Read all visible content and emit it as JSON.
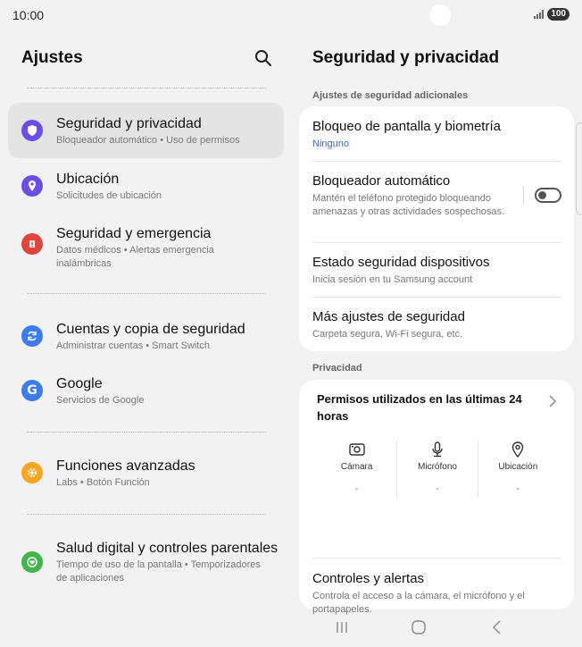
{
  "status": {
    "time": "10:00",
    "battery": "100"
  },
  "left": {
    "title": "Ajustes",
    "items": [
      {
        "title": "Seguridad y privacidad",
        "subtitle": "Bloqueador automático • Uso de permisos",
        "icon": "shield-icon",
        "color": "#6c4ee6"
      },
      {
        "title": "Ubicación",
        "subtitle": "Solicitudes de ubicación",
        "icon": "location-pin-icon",
        "color": "#6c4ee6"
      },
      {
        "title": "Seguridad y emergencia",
        "subtitle": "Datos médicos • Alertas emergencia inalámbricas",
        "icon": "emergency-icon",
        "color": "#e0443b"
      },
      {
        "title": "Cuentas y copia de seguridad",
        "subtitle": "Administrar cuentas • Smart Switch",
        "icon": "sync-icon",
        "color": "#3b7bea"
      },
      {
        "title": "Google",
        "subtitle": "Servicios de Google",
        "icon": "google-icon",
        "color": "#3b7bea"
      },
      {
        "title": "Funciones avanzadas",
        "subtitle": "Labs • Botón Función",
        "icon": "gear-plus-icon",
        "color": "#f5a623"
      },
      {
        "title": "Salud digital y controles parentales",
        "subtitle": "Tiempo de uso de la pantalla • Temporizadores de aplicaciones",
        "icon": "heart-circle-icon",
        "color": "#3fb54a"
      }
    ]
  },
  "right": {
    "title": "Seguridad y privacidad",
    "section1_label": "Ajustes de seguridad adicionales",
    "rows1": [
      {
        "title": "Bloqueo de pantalla y biometría",
        "subtitle": "Ninguno"
      },
      {
        "title": "Bloqueador automático",
        "subtitle": "Mantén el teléfono protegido bloqueando amenazas y otras actividades sospechosas."
      },
      {
        "title": "Estado seguridad dispositivos",
        "subtitle": "Inicia sesión en tu Samsung account"
      },
      {
        "title": "Más ajustes de seguridad",
        "subtitle": "Carpeta segura, Wi-Fi segura, etc."
      }
    ],
    "section2_label": "Privacidad",
    "permissions": {
      "title": "Permisos utilizados en las últimas 24 horas",
      "items": [
        {
          "label": "Cámara",
          "value": "-",
          "icon": "camera-icon"
        },
        {
          "label": "Micrófono",
          "value": "-",
          "icon": "microphone-icon"
        },
        {
          "label": "Ubicación",
          "value": "-",
          "icon": "location-icon"
        }
      ]
    },
    "controls": {
      "title": "Controles y alertas",
      "subtitle": "Controla el acceso a la cámara, el micrófono y el portapapeles."
    }
  },
  "accent": "#2b6fd6"
}
